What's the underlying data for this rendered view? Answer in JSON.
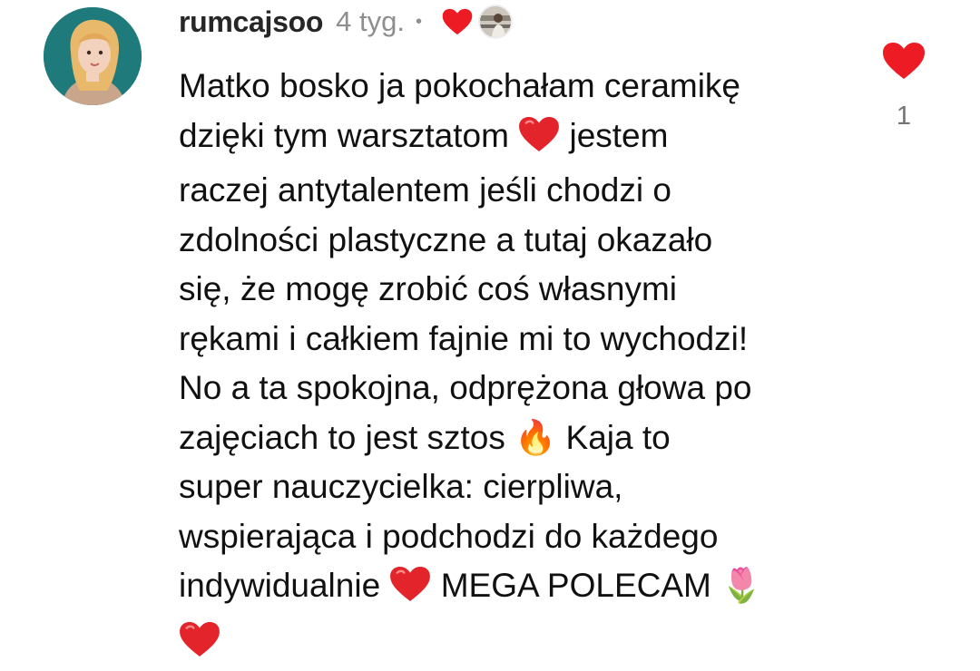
{
  "comment": {
    "username": "rumcajsoo",
    "time": "4 tyg.",
    "separator": "•",
    "text_parts": [
      "Matko bosko ja pokochałam ceramikę\ndzięki tym warsztatom ",
      " jestem\nraczej antytalentem jeśli chodzi o\nzdolności plastyczne a tutaj okazało\nsię, że mogę zrobić coś własnymi\nrękami i całkiem fajnie mi to wychodzi!\nNo a ta spokojna, odprężona głowa po\nzajęciach to jest sztos 🔥 Kaja to\nsuper nauczycielka: cierpliwa,\nwspierająca i podchodzi do każdego\nindywidualnie ",
      " MEGA POLECAM 🌷\n"
    ],
    "like_count": "1"
  },
  "icons": {
    "like": "heart-outline-red-filled-icon",
    "creator_liked": "heart-icon",
    "inline_emoji": "red-heart-emoji"
  },
  "colors": {
    "heart": "#ed1c24",
    "username": "#262626",
    "meta": "#8e8e8e",
    "avatar_bg": "#1f7b7b"
  }
}
